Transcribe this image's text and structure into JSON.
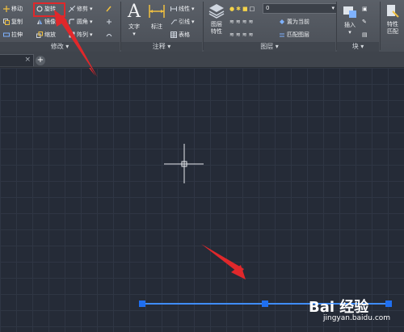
{
  "ribbon": {
    "modify": {
      "move": "移动",
      "rotate": "旋转",
      "trim": "修剪",
      "copy": "复制",
      "mirror": "镜像",
      "fillet": "圆角",
      "stretch": "拉伸",
      "scale": "缩放",
      "array": "阵列",
      "panel_title": "修改"
    },
    "annotation": {
      "text": "文字",
      "dimension": "标注",
      "linear": "线性",
      "leader": "引线",
      "table": "表格",
      "panel_title": "注释"
    },
    "layers": {
      "layer_properties": "图层\n特性",
      "current_layer": "0",
      "set_current": "置为当前",
      "match_layer": "匹配图层",
      "panel_title": "图层"
    },
    "block": {
      "insert": "插入",
      "panel_title": "块"
    },
    "properties": {
      "match_properties": "特性\n匹配"
    }
  },
  "tabs": {
    "add": "+",
    "close": "×"
  },
  "watermark": {
    "brand": "Bai 经验",
    "url": "jingyan.baidu.com"
  },
  "colors": {
    "highlight": "#e0282b",
    "selection": "#3f8dff",
    "grip": "#1f6ff0",
    "canvas": "#252b37"
  }
}
